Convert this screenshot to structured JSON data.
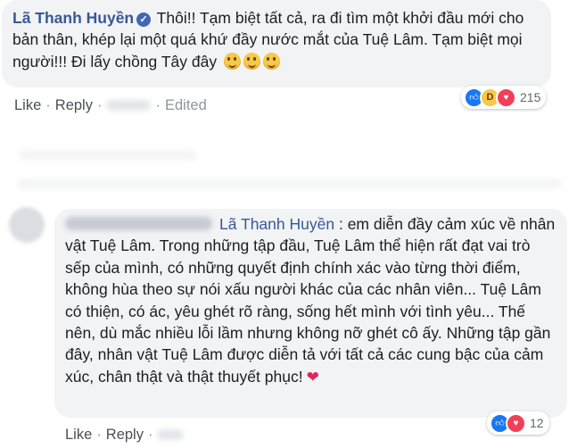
{
  "comment1": {
    "author": "Lã Thanh Huyền",
    "verified_icon": "check-icon",
    "text": "Thôi!! Tạm biệt tất cả, ra đi tìm một khởi đầu mới cho bản thân, khép lại một quá khứ đầy nước mắt của Tuệ Lâm. Tạm biệt mọi người!!! Đi lấy chồng Tây đây",
    "reaction_count": "215",
    "actions": {
      "like": "Like",
      "reply": "Reply",
      "edited": "Edited"
    }
  },
  "comment2": {
    "tagged_name": "Lã Thanh Huyền",
    "text": ": em diễn đầy cảm xúc về nhân vật Tuệ Lâm. Trong những tập đầu, Tuệ Lâm thể hiện rất đạt vai trò sếp của mình, có những quyết định chính xác vào từng thời điểm, không hùa theo sự nói xấu người khác của các nhân viên... Tuệ Lâm có thiện, có ác, yêu ghét rõ ràng, sống hết mình với tình yêu... Thế nên, dù mắc nhiều lỗi lầm nhưng không nỡ ghét cô ấy. Những tập gần đây, nhân vật Tuệ Lâm được diễn tả với tất cả các cung bậc của cảm xúc, chân thật và thật thuyết phục!",
    "reaction_count": "12",
    "actions": {
      "like": "Like",
      "reply": "Reply"
    }
  },
  "icons": {
    "like": "thumbs-up-icon",
    "haha": "laughing-face-icon",
    "love": "heart-icon",
    "emoji": "smirk-face-icon",
    "heart_emoji": "two-hearts-icon"
  },
  "colors": {
    "link": "#385898",
    "bubble_bg": "#f2f3f5",
    "like_blue": "#1877f2",
    "love_red": "#f33e58"
  }
}
